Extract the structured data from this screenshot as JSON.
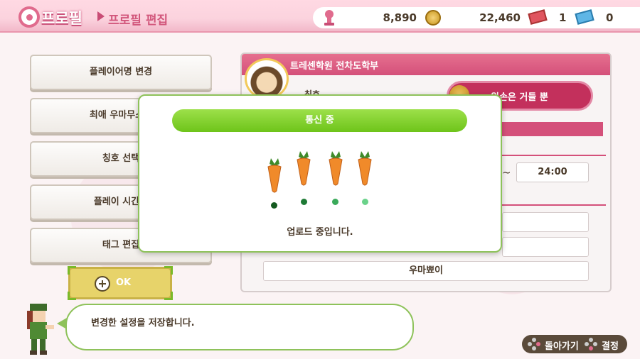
{
  "header": {
    "title": "프로필",
    "breadcrumb": "프로필 편집"
  },
  "currency": {
    "trophy_count": "8,890",
    "coins": "22,460",
    "ticket_red": "1",
    "ticket_blue": "0"
  },
  "menu": [
    "플레이어명 변경",
    "최애 우마무스메",
    "칭호 선택",
    "플레이 시간대",
    "태그 편집"
  ],
  "ok_label": "OK",
  "message": "변경한 설정을 저장합니다.",
  "profile": {
    "school": "트레센학원 전차도학부",
    "title_label": "칭호",
    "title_value": "왼손은 거들 뿐",
    "time_end": "24:00",
    "tag_last": "우마뾰이"
  },
  "dialog": {
    "title": "통신 중",
    "message": "업로드 중입니다."
  },
  "footer": {
    "back": "돌아가기",
    "confirm": "결정"
  },
  "colors": {
    "accent_pink": "#d4507a",
    "accent_green": "#7ac41a",
    "carrot": "#f08a2a"
  }
}
